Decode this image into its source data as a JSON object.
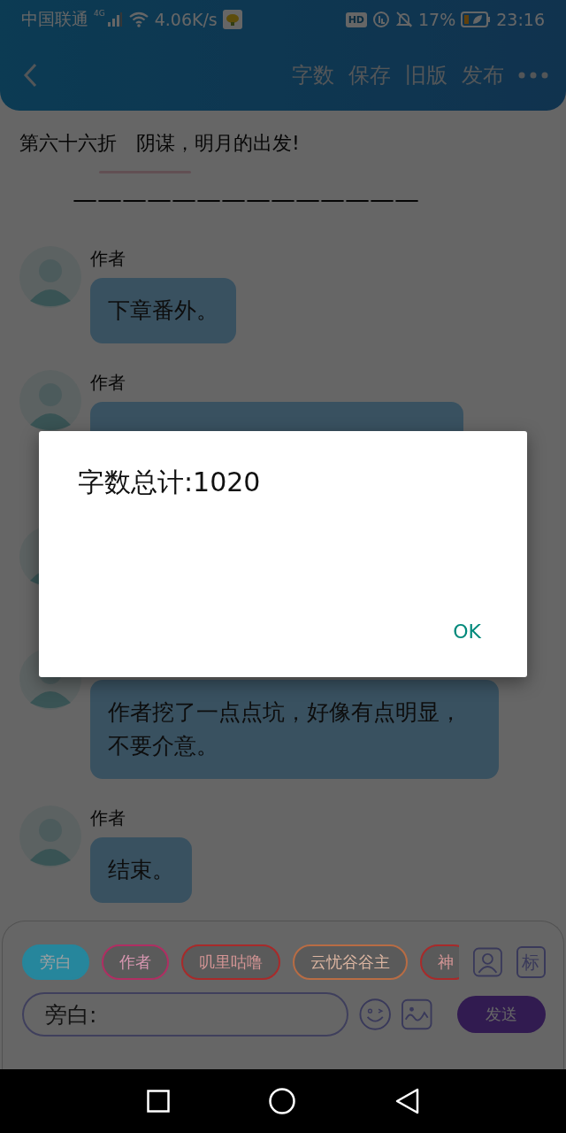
{
  "status_bar": {
    "carrier": "中国联通",
    "network": "4G",
    "speed": "4.06K/s",
    "hd": "HD",
    "battery": "17%",
    "time": "23:16"
  },
  "header": {
    "actions": [
      "字数",
      "保存",
      "旧版",
      "发布"
    ]
  },
  "chapter_title": "第六十六折　阴谋，明月的出发!",
  "divider_text": "——————————————",
  "messages": [
    {
      "kind": "text",
      "name": "作者",
      "text": "下章番外。"
    },
    {
      "kind": "covered",
      "name": "作者"
    },
    {
      "kind": "hidden"
    },
    {
      "kind": "text",
      "text": "作者挖了一点点坑，好像有点明显，不要介意。"
    },
    {
      "kind": "text",
      "name": "作者",
      "text": "结束。"
    }
  ],
  "roles": [
    {
      "label": "旁白",
      "color": "#26869c",
      "selected": true
    },
    {
      "label": "作者",
      "color": "#b02e62",
      "selected": false
    },
    {
      "label": "叽里咕噜",
      "color": "#a82a2a",
      "selected": false
    },
    {
      "label": "云忧谷谷主",
      "color": "#b86c44",
      "selected": false
    },
    {
      "label": "神",
      "color": "#a82a2a",
      "selected": false
    }
  ],
  "tag_button": "标",
  "input": {
    "placeholder": "旁白:"
  },
  "send_button": "发送",
  "dialog": {
    "message": "字数总计:1020",
    "button": "OK"
  }
}
